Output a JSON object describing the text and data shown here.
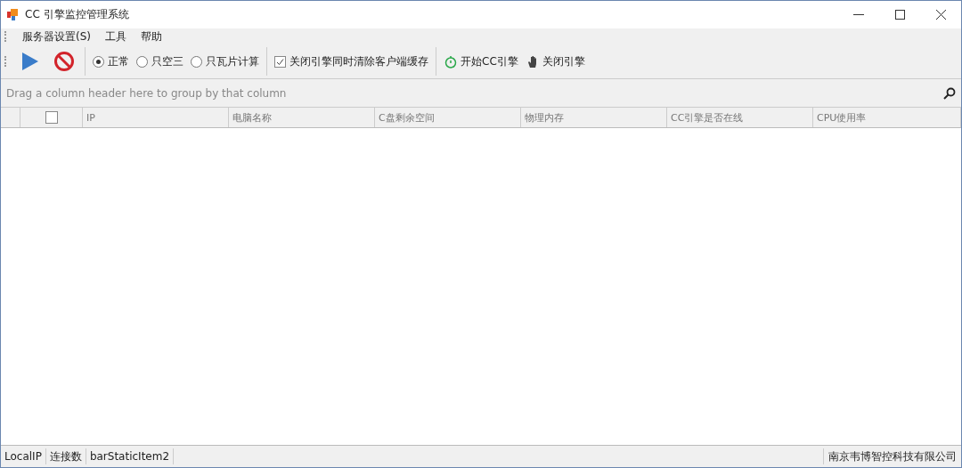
{
  "window": {
    "title": "CC 引擎监控管理系统"
  },
  "menu": [
    "服务器设置(S)",
    "工具",
    "帮助"
  ],
  "toolbar": {
    "modes": [
      {
        "label": "正常",
        "selected": true
      },
      {
        "label": "只空三",
        "selected": false
      },
      {
        "label": "只瓦片计算",
        "selected": false
      }
    ],
    "clear_cache": {
      "label": "关闭引擎同时清除客户端缓存",
      "checked": true
    },
    "start": "开始CC引擎",
    "stop": "关闭引擎"
  },
  "group_panel": "Drag a column header here to group by that column",
  "table": {
    "select_all": false,
    "columns": [
      "IP",
      "电脑名称",
      "C盘剩余空间",
      "物理内存",
      "CC引擎是否在线",
      "CPU使用率"
    ]
  },
  "status_bar": {
    "items": [
      "LocalIP",
      "连接数",
      "barStaticItem2"
    ],
    "company": "南京韦博智控科技有限公司"
  }
}
